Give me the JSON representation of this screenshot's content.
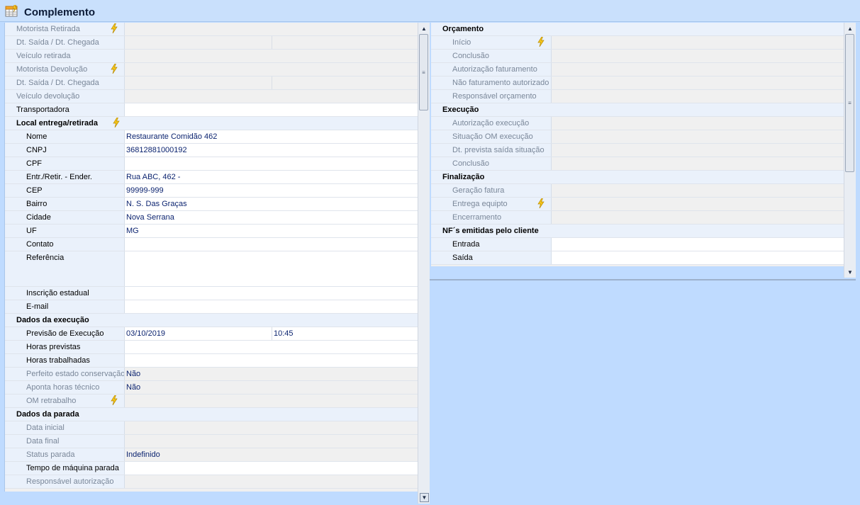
{
  "window": {
    "title": "Complemento"
  },
  "left": {
    "rows": [
      {
        "label": "Motorista Retirada",
        "level": 0,
        "style": "ro",
        "value": "",
        "bolt": true
      },
      {
        "label": "Dt. Saída / Dt. Chegada",
        "level": 0,
        "style": "ro",
        "value": "",
        "value2": "",
        "split": true
      },
      {
        "label": "Veículo retirada",
        "level": 0,
        "style": "ro",
        "value": ""
      },
      {
        "label": "Motorista Devolução",
        "level": 0,
        "style": "ro",
        "value": "",
        "bolt": true
      },
      {
        "label": "Dt. Saída / Dt. Chegada",
        "level": 0,
        "style": "ro",
        "value": "",
        "value2": "",
        "split": true
      },
      {
        "label": "Veículo devolução",
        "level": 0,
        "style": "ro",
        "value": ""
      },
      {
        "label": "Transportadora",
        "level": 0,
        "style": "edit",
        "value": ""
      },
      {
        "label": "Local entrega/retirada",
        "level": 0,
        "style": "hdr",
        "bolt": true
      },
      {
        "label": "Nome",
        "level": 1,
        "style": "edit",
        "value": "Restaurante Comidão 462"
      },
      {
        "label": "CNPJ",
        "level": 1,
        "style": "edit",
        "value": "36812881000192"
      },
      {
        "label": "CPF",
        "level": 1,
        "style": "edit",
        "value": ""
      },
      {
        "label": "Entr./Retir. - Ender.",
        "level": 1,
        "style": "edit",
        "value": "Rua ABC, 462 -"
      },
      {
        "label": "CEP",
        "level": 1,
        "style": "edit",
        "value": "99999-999"
      },
      {
        "label": "Bairro",
        "level": 1,
        "style": "edit",
        "value": "N. S. Das Graças"
      },
      {
        "label": "Cidade",
        "level": 1,
        "style": "edit",
        "value": "Nova Serrana"
      },
      {
        "label": "UF",
        "level": 1,
        "style": "edit",
        "value": "MG"
      },
      {
        "label": "Contato",
        "level": 1,
        "style": "edit",
        "value": ""
      },
      {
        "label": "Referência",
        "level": 1,
        "style": "edit",
        "value": "",
        "tall": true
      },
      {
        "label": "Inscrição estadual",
        "level": 1,
        "style": "edit",
        "value": ""
      },
      {
        "label": "E-mail",
        "level": 1,
        "style": "edit",
        "value": ""
      },
      {
        "label": "Dados da execução",
        "level": 0,
        "style": "hdr"
      },
      {
        "label": "Previsão de Execução",
        "level": 1,
        "style": "edit",
        "value": "03/10/2019",
        "value2": "10:45",
        "split": true
      },
      {
        "label": "Horas previstas",
        "level": 1,
        "style": "edit",
        "value": ""
      },
      {
        "label": "Horas trabalhadas",
        "level": 1,
        "style": "edit",
        "value": ""
      },
      {
        "label": "Perfeito estado conservação",
        "level": 1,
        "style": "ro",
        "value": "Não"
      },
      {
        "label": "Aponta horas técnico",
        "level": 1,
        "style": "ro",
        "value": "Não"
      },
      {
        "label": "OM retrabalho",
        "level": 1,
        "style": "ro",
        "value": "",
        "bolt": true
      },
      {
        "label": "Dados da parada",
        "level": 0,
        "style": "hdr"
      },
      {
        "label": "Data inicial",
        "level": 1,
        "style": "ro",
        "value": ""
      },
      {
        "label": "Data final",
        "level": 1,
        "style": "ro",
        "value": ""
      },
      {
        "label": "Status parada",
        "level": 1,
        "style": "ro",
        "value": "Indefinido"
      },
      {
        "label": "Tempo de máquina parada",
        "level": 1,
        "style": "edit",
        "value": ""
      },
      {
        "label": "Responsável autorização",
        "level": 1,
        "style": "ro",
        "value": ""
      }
    ]
  },
  "right": {
    "rows": [
      {
        "label": "Orçamento",
        "level": 0,
        "style": "hdr"
      },
      {
        "label": "Início",
        "level": 1,
        "style": "ro",
        "value": "",
        "bolt": true
      },
      {
        "label": "Conclusão",
        "level": 1,
        "style": "ro",
        "value": ""
      },
      {
        "label": "Autorização faturamento",
        "level": 1,
        "style": "ro",
        "value": ""
      },
      {
        "label": "Não faturamento autorizado",
        "level": 1,
        "style": "ro",
        "value": ""
      },
      {
        "label": "Responsável orçamento",
        "level": 1,
        "style": "ro",
        "value": ""
      },
      {
        "label": "Execução",
        "level": 0,
        "style": "hdr"
      },
      {
        "label": "Autorização execução",
        "level": 1,
        "style": "ro",
        "value": ""
      },
      {
        "label": "Situação OM execução",
        "level": 1,
        "style": "ro",
        "value": ""
      },
      {
        "label": "Dt. prevista saída situação",
        "level": 1,
        "style": "ro",
        "value": ""
      },
      {
        "label": "Conclusão",
        "level": 1,
        "style": "ro",
        "value": ""
      },
      {
        "label": "Finalização",
        "level": 0,
        "style": "hdr"
      },
      {
        "label": "Geração fatura",
        "level": 1,
        "style": "ro",
        "value": ""
      },
      {
        "label": "Entrega equipto",
        "level": 1,
        "style": "ro",
        "value": "",
        "bolt": true
      },
      {
        "label": "Encerramento",
        "level": 1,
        "style": "ro",
        "value": ""
      },
      {
        "label": "NF´s emitidas pelo cliente",
        "level": 0,
        "style": "hdr"
      },
      {
        "label": "Entrada",
        "level": 1,
        "style": "edit",
        "value": ""
      },
      {
        "label": "Saída",
        "level": 1,
        "style": "edit",
        "value": ""
      }
    ]
  },
  "icons": {
    "title": "grid-table-icon",
    "bolt": "lightning-bolt-icon"
  }
}
